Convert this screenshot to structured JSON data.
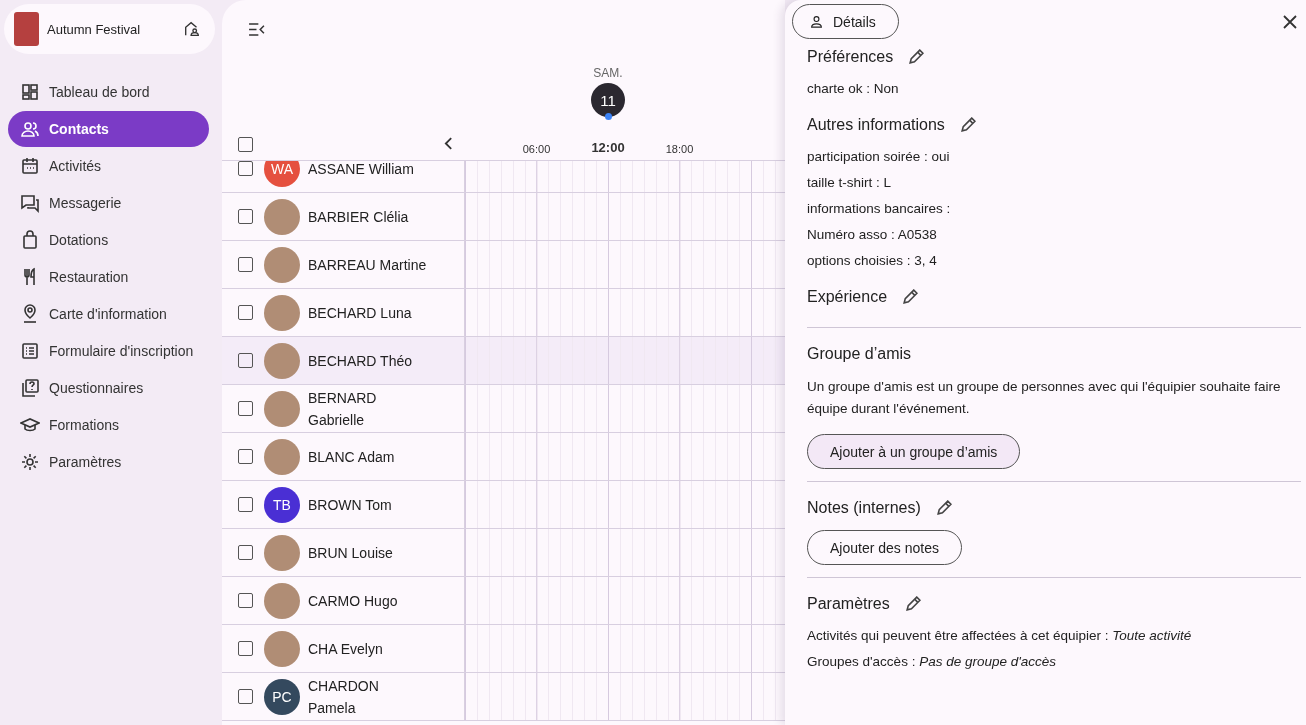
{
  "sidebar": {
    "event_name": "Autumn Festival",
    "items": [
      {
        "label": "Tableau de bord",
        "selected": false
      },
      {
        "label": "Contacts",
        "selected": true
      },
      {
        "label": "Activités",
        "selected": false
      },
      {
        "label": "Messagerie",
        "selected": false
      },
      {
        "label": "Dotations",
        "selected": false
      },
      {
        "label": "Restauration",
        "selected": false
      },
      {
        "label": "Carte d'information",
        "selected": false
      },
      {
        "label": "Formulaire d'inscription",
        "selected": false
      },
      {
        "label": "Questionnaires",
        "selected": false
      },
      {
        "label": "Formations",
        "selected": false
      },
      {
        "label": "Paramètres",
        "selected": false
      }
    ]
  },
  "timeline": {
    "day": "SAM.",
    "date": "11",
    "hours": [
      {
        "label": "06:00",
        "current": false
      },
      {
        "label": "12:00",
        "current": true
      },
      {
        "label": "18:00",
        "current": false
      }
    ],
    "select_all": {
      "checked": false
    }
  },
  "contacts": [
    {
      "name": "ASSANE William",
      "checked": false,
      "selected": false,
      "avatar": {
        "kind": "initials",
        "initials": "WA",
        "color": "#e5503f"
      }
    },
    {
      "name": "BARBIER Clélia",
      "checked": false,
      "selected": false,
      "avatar": {
        "kind": "photo"
      }
    },
    {
      "name": "BARREAU Martine",
      "checked": false,
      "selected": false,
      "avatar": {
        "kind": "photo"
      }
    },
    {
      "name": "BECHARD Luna",
      "checked": false,
      "selected": false,
      "avatar": {
        "kind": "photo"
      }
    },
    {
      "name": "BECHARD Théo",
      "checked": false,
      "selected": true,
      "avatar": {
        "kind": "photo"
      }
    },
    {
      "name": "BERNARD Gabrielle",
      "checked": false,
      "selected": false,
      "avatar": {
        "kind": "photo"
      }
    },
    {
      "name": "BLANC Adam",
      "checked": false,
      "selected": false,
      "avatar": {
        "kind": "photo"
      }
    },
    {
      "name": "BROWN Tom",
      "checked": false,
      "selected": false,
      "avatar": {
        "kind": "initials",
        "initials": "TB",
        "color": "#4a2fd4"
      }
    },
    {
      "name": "BRUN Louise",
      "checked": false,
      "selected": false,
      "avatar": {
        "kind": "photo"
      }
    },
    {
      "name": "CARMO Hugo",
      "checked": false,
      "selected": false,
      "avatar": {
        "kind": "photo"
      }
    },
    {
      "name": "CHA Evelyn",
      "checked": false,
      "selected": false,
      "avatar": {
        "kind": "photo"
      }
    },
    {
      "name": "CHARDON Pamela",
      "checked": false,
      "selected": false,
      "avatar": {
        "kind": "initials",
        "initials": "PC",
        "color": "#34495e"
      }
    }
  ],
  "details": {
    "tab": "Détails",
    "blocks": [
      [
        {
          "title": "Préférences",
          "editable": true,
          "fields": [
            "charte ok : Non"
          ]
        },
        {
          "title": "Autres informations",
          "editable": true,
          "fields": [
            "participation soirée : oui",
            "taille t-shirt : L",
            "informations bancaires :",
            "Numéro asso : A0538",
            "options choisies : 3, 4"
          ]
        },
        {
          "title": "Expérience",
          "editable": true
        }
      ],
      [
        {
          "title": "Groupe d’amis",
          "editable": false,
          "description": "Un groupe d'amis est un groupe de personnes avec qui l'équipier souhaite faire équipe durant l'événement.",
          "button": {
            "label": "Ajouter à un groupe d’amis",
            "kind": "tonal"
          }
        }
      ],
      [
        {
          "title": "Notes (internes)",
          "editable": true,
          "button": {
            "label": "Ajouter des notes",
            "kind": "outlined"
          }
        }
      ],
      [
        {
          "title": "Paramètres",
          "editable": true,
          "fields": [
            "Activités qui peuvent être affectées à cet équipier : *Toute activité*",
            "Groupes d'accès : *Pas de groupe d'accès*"
          ]
        }
      ]
    ]
  }
}
